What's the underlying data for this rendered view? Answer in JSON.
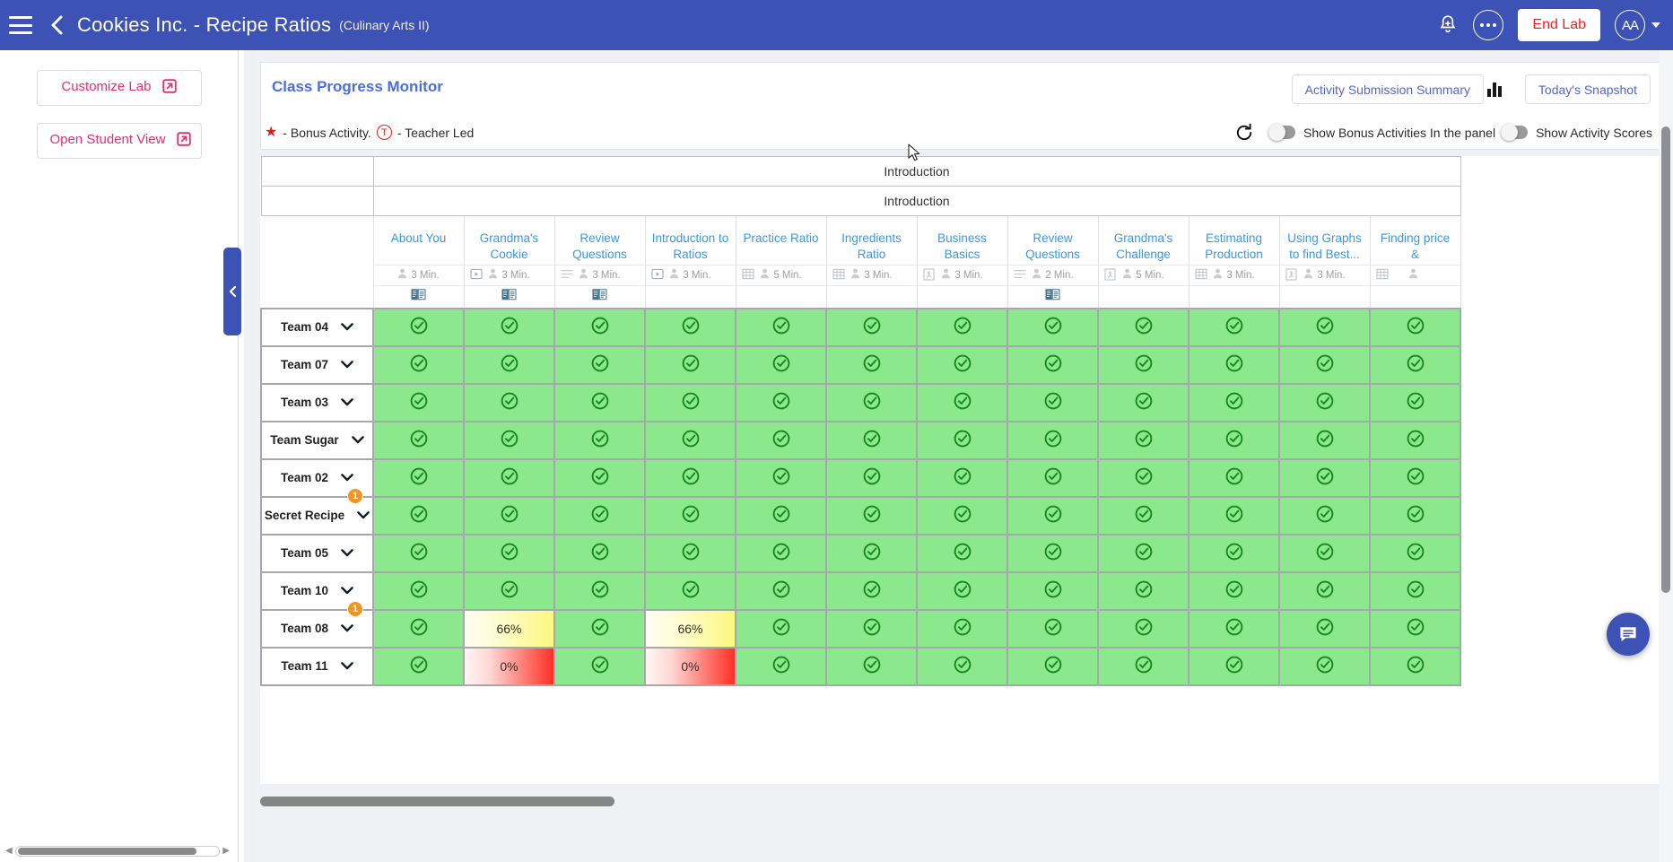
{
  "appbar": {
    "menu_icon": "hamburger-icon",
    "back_icon": "chevron-left-icon",
    "title": "Cookies Inc. - Recipe Ratios",
    "subtitle": "(Culinary Arts II)",
    "bell_icon": "bell-add-icon",
    "more_icon": "more-options-icon",
    "end_lab_label": "End Lab",
    "end_lab_color": "#ff1b1b",
    "avatar_label": "AA",
    "brand_color": "#3d52b5"
  },
  "left_panel": {
    "customize_lab_label": "Customize Lab",
    "open_student_view_label": "Open Student View",
    "external_link_icon": "external-link-icon",
    "accent_color": "#ee2c6a"
  },
  "collapse_handle": {
    "icon": "chevron-left-icon"
  },
  "toolbar": {
    "title": "Class Progress Monitor",
    "activity_summary_label": "Activity Submission Summary",
    "chart_icon": "bar-chart-icon",
    "todays_snapshot_label": "Today's Snapshot",
    "title_color": "#4a6ee0"
  },
  "legend": {
    "star_icon": "star-icon",
    "bonus_text": "- Bonus Activity.",
    "teacher_led_badge": "T",
    "teacher_led_text": "- Teacher Led",
    "refresh_icon": "refresh-icon",
    "toggle_bonus_label": "Show Bonus Activities In the panel",
    "toggle_bonus_on": false,
    "toggle_scores_label": "Show Activity Scores",
    "toggle_scores_on": false
  },
  "grid": {
    "group_row_1": "Introduction",
    "group_row_2": "Introduction",
    "activities": [
      {
        "title": "About You",
        "type_icon": "",
        "duration": "3 Min.",
        "book": true
      },
      {
        "title": "Grandma's Cookie",
        "type_icon": "video-icon",
        "duration": "3 Min.",
        "book": true
      },
      {
        "title": "Review Questions",
        "type_icon": "list-icon",
        "duration": "3 Min.",
        "book": true
      },
      {
        "title": "Introduction to Ratios",
        "type_icon": "video-icon",
        "duration": "3 Min.",
        "book": false
      },
      {
        "title": "Practice Ratio",
        "type_icon": "table-icon",
        "duration": "5 Min.",
        "book": false
      },
      {
        "title": "Ingredients Ratio",
        "type_icon": "table-icon",
        "duration": "3 Min.",
        "book": false
      },
      {
        "title": "Business Basics",
        "type_icon": "pdf-icon",
        "duration": "3 Min.",
        "book": false
      },
      {
        "title": "Review Questions",
        "type_icon": "list-icon",
        "duration": "2 Min.",
        "book": true
      },
      {
        "title": "Grandma's Challenge",
        "type_icon": "pdf-icon",
        "duration": "5 Min.",
        "book": false
      },
      {
        "title": "Estimating Production",
        "type_icon": "table-icon",
        "duration": "3 Min.",
        "book": false
      },
      {
        "title": "Using Graphs to find Best...",
        "type_icon": "pdf-icon",
        "duration": "3 Min.",
        "book": false
      },
      {
        "title": "Finding price &",
        "type_icon": "table-icon",
        "duration": "",
        "book": false
      }
    ],
    "check_icon": "check-circle-icon",
    "chevron_icon": "chevron-down-icon",
    "rows": [
      {
        "name": "Team 04",
        "badge": null,
        "cells": [
          "done",
          "done",
          "done",
          "done",
          "done",
          "done",
          "done",
          "done",
          "done",
          "done",
          "done",
          "done"
        ]
      },
      {
        "name": "Team 07",
        "badge": null,
        "cells": [
          "done",
          "done",
          "done",
          "done",
          "done",
          "done",
          "done",
          "done",
          "done",
          "done",
          "done",
          "done"
        ]
      },
      {
        "name": "Team 03",
        "badge": null,
        "cells": [
          "done",
          "done",
          "done",
          "done",
          "done",
          "done",
          "done",
          "done",
          "done",
          "done",
          "done",
          "done"
        ]
      },
      {
        "name": "Team Sugar",
        "badge": null,
        "cells": [
          "done",
          "done",
          "done",
          "done",
          "done",
          "done",
          "done",
          "done",
          "done",
          "done",
          "done",
          "done"
        ]
      },
      {
        "name": "Team 02",
        "badge": "1",
        "cells": [
          "done",
          "done",
          "done",
          "done",
          "done",
          "done",
          "done",
          "done",
          "done",
          "done",
          "done",
          "done"
        ]
      },
      {
        "name": "Secret Recipe",
        "badge": null,
        "cells": [
          "done",
          "done",
          "done",
          "done",
          "done",
          "done",
          "done",
          "done",
          "done",
          "done",
          "done",
          "done"
        ]
      },
      {
        "name": "Team 05",
        "badge": null,
        "cells": [
          "done",
          "done",
          "done",
          "done",
          "done",
          "done",
          "done",
          "done",
          "done",
          "done",
          "done",
          "done"
        ]
      },
      {
        "name": "Team 10",
        "badge": "1",
        "cells": [
          "done",
          "done",
          "done",
          "done",
          "done",
          "done",
          "done",
          "done",
          "done",
          "done",
          "done",
          "done"
        ]
      },
      {
        "name": "Team 08",
        "badge": null,
        "cells": [
          "done",
          "66%",
          "done",
          "66%",
          "done",
          "done",
          "done",
          "done",
          "done",
          "done",
          "done",
          "done"
        ]
      },
      {
        "name": "Team 11",
        "badge": null,
        "cells": [
          "done",
          "0%",
          "done",
          "0%",
          "done",
          "done",
          "done",
          "done",
          "done",
          "done",
          "done",
          "done"
        ]
      }
    ],
    "colors": {
      "done": "#8ce88c",
      "warn": "#fcf87f",
      "bad": "#ff2f26",
      "badge": "#f5931e"
    }
  },
  "fab": {
    "icon": "chat-icon"
  }
}
